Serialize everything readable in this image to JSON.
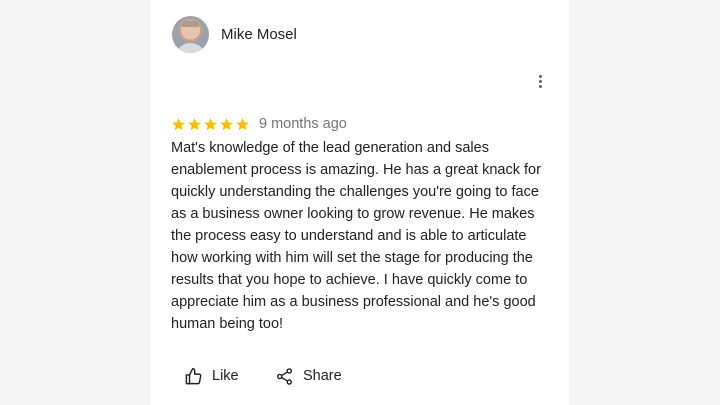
{
  "review": {
    "author_name": "Mike Mosel",
    "rating": 5,
    "rating_max": 5,
    "time_ago": "9 months ago",
    "text": "Mat's knowledge of the lead generation and sales\nenablement process is amazing.  He has a great knack for\nquickly understanding the challenges you're going to face\nas a business owner looking to grow revenue.  He makes\nthe process easy to understand and is able to articulate\nhow working with him will set the stage for producing the\nresults that you hope to achieve.  I have quickly come to\nappreciate him as a business professional and he's good\nhuman being too!",
    "star_color": "#fbbc04"
  },
  "actions": {
    "like_label": "Like",
    "share_label": "Share"
  },
  "icons": {
    "avatar": "avatar-photo",
    "menu": "more-vert-icon",
    "star": "star-icon",
    "like": "thumbs-up-icon",
    "share": "share-icon"
  }
}
